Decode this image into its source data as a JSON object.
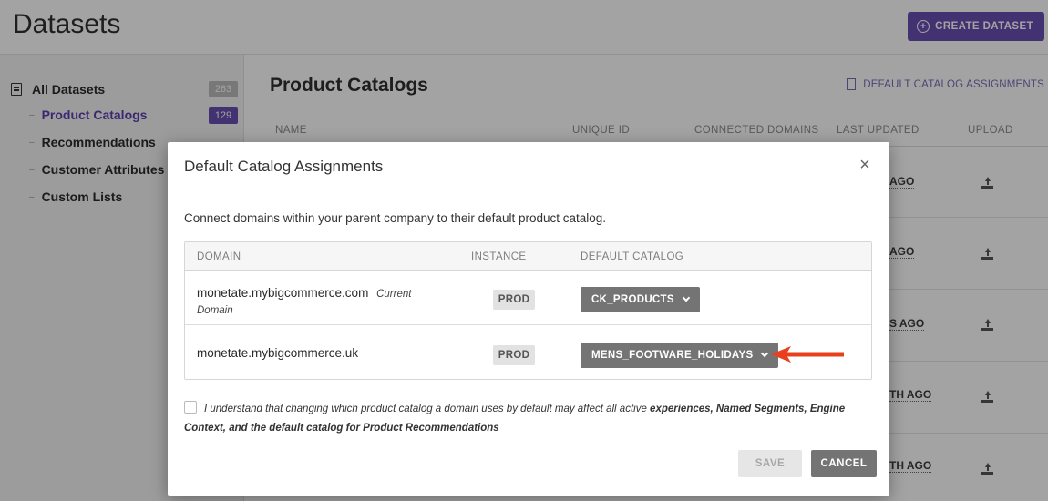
{
  "page": {
    "title": "Datasets",
    "create_button": "CREATE DATASET"
  },
  "sidebar": {
    "all_datasets": {
      "label": "All Datasets",
      "count": "263"
    },
    "items": [
      {
        "label": "Product Catalogs",
        "count": "129",
        "active": true
      },
      {
        "label": "Recommendations"
      },
      {
        "label": "Customer Attributes"
      },
      {
        "label": "Custom Lists"
      }
    ]
  },
  "content": {
    "title": "Product Catalogs",
    "default_link": "DEFAULT CATALOG ASSIGNMENTS",
    "columns": [
      "NAME",
      "UNIQUE ID",
      "CONNECTED DOMAINS",
      "LAST UPDATED",
      "UPLOAD"
    ],
    "visible_last_updated": [
      "AGO",
      "AGO",
      "S AGO",
      "TH AGO",
      "TH AGO"
    ]
  },
  "modal": {
    "title": "Default Catalog Assignments",
    "close_symbol": "×",
    "description": "Connect domains within your parent company to their default product catalog.",
    "table_headers": {
      "domain": "DOMAIN",
      "instance": "INSTANCE",
      "default_catalog": "DEFAULT CATALOG"
    },
    "rows": [
      {
        "domain": "monetate.mybigcommerce.com",
        "note": "Current",
        "note2": "Domain",
        "instance": "PROD",
        "catalog": "CK_PRODUCTS"
      },
      {
        "domain": "monetate.mybigcommerce.uk",
        "instance": "PROD",
        "catalog": "MENS_FOOTWARE_HOLIDAYS"
      }
    ],
    "ack": {
      "text_1": "I understand that changing which product catalog a domain uses by default may affect all active ",
      "bold_1": "experiences, Named Segments, Engine Context,",
      "text_2": " ",
      "bold_2": "and the default catalog for Product Recommendations",
      "checked": false
    },
    "save_label": "SAVE",
    "cancel_label": "CANCEL"
  },
  "colors": {
    "accent": "#6a4fb3",
    "select_bg": "#747474",
    "arrow": "#e8401c"
  }
}
